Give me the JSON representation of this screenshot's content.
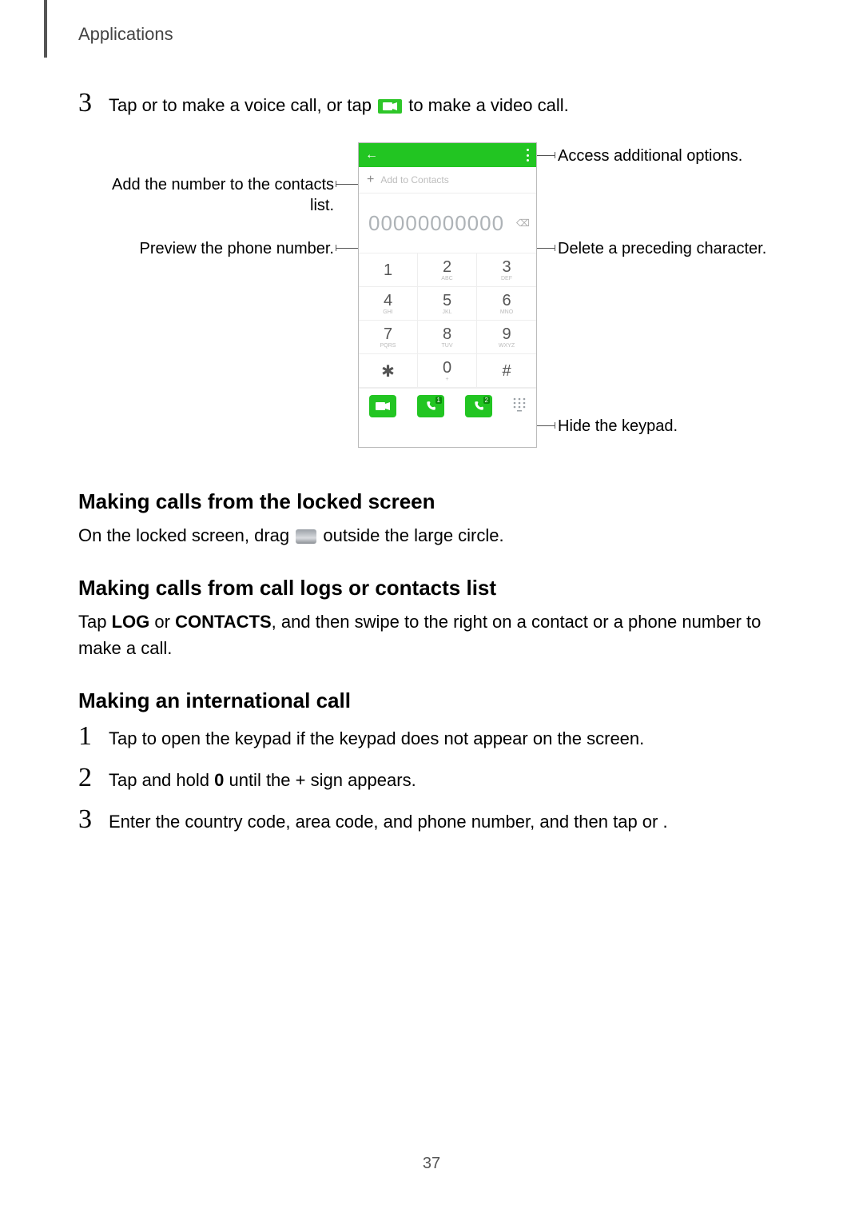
{
  "header": {
    "section": "Applications"
  },
  "step3_top": {
    "num": "3",
    "part1": "Tap ",
    "part2": " or ",
    "part3": " to make a voice call, or tap ",
    "part4": " to make a video call."
  },
  "callouts": {
    "access": "Access additional options.",
    "add_contacts_l1": "Add the number to the contacts",
    "add_contacts_l2": "list.",
    "preview": "Preview the phone number.",
    "delete": "Delete a preceding character.",
    "hide": "Hide the keypad."
  },
  "phone": {
    "back_arrow": "←",
    "add_label": "Add to Contacts",
    "digits": "00000000000",
    "del_glyph": "⌫",
    "keys": [
      {
        "m": "1",
        "s": ""
      },
      {
        "m": "2",
        "s": "ABC"
      },
      {
        "m": "3",
        "s": "DEF"
      },
      {
        "m": "4",
        "s": "GHI"
      },
      {
        "m": "5",
        "s": "JKL"
      },
      {
        "m": "6",
        "s": "MNO"
      },
      {
        "m": "7",
        "s": "PQRS"
      },
      {
        "m": "8",
        "s": "TUV"
      },
      {
        "m": "9",
        "s": "WXYZ"
      },
      {
        "m": "✱",
        "s": ""
      },
      {
        "m": "0",
        "s": "+"
      },
      {
        "m": "#",
        "s": ""
      }
    ],
    "sim1": "1",
    "sim2": "2",
    "hide_glyph": "⋮⋮⋮"
  },
  "h_locked": "Making calls from the locked screen",
  "p_locked_a": "On the locked screen, drag ",
  "p_locked_b": " outside the large circle.",
  "h_logs": "Making calls from call logs or contacts list",
  "p_logs_a": "Tap ",
  "p_logs_log": "LOG",
  "p_logs_b": " or ",
  "p_logs_contacts": "CONTACTS",
  "p_logs_c": ", and then swipe to the right on a contact or a phone number to make a call.",
  "h_intl": "Making an international call",
  "steps_intl": {
    "s1": {
      "num": "1",
      "txt": "Tap     to open the keypad if the keypad does not appear on the screen."
    },
    "s2": {
      "num": "2",
      "a": "Tap and hold ",
      "zero": "0",
      "b": " until the + sign appears."
    },
    "s3": {
      "num": "3",
      "txt": "Enter the country code, area code, and phone number, and then tap     or    ."
    }
  },
  "page_number": "37"
}
